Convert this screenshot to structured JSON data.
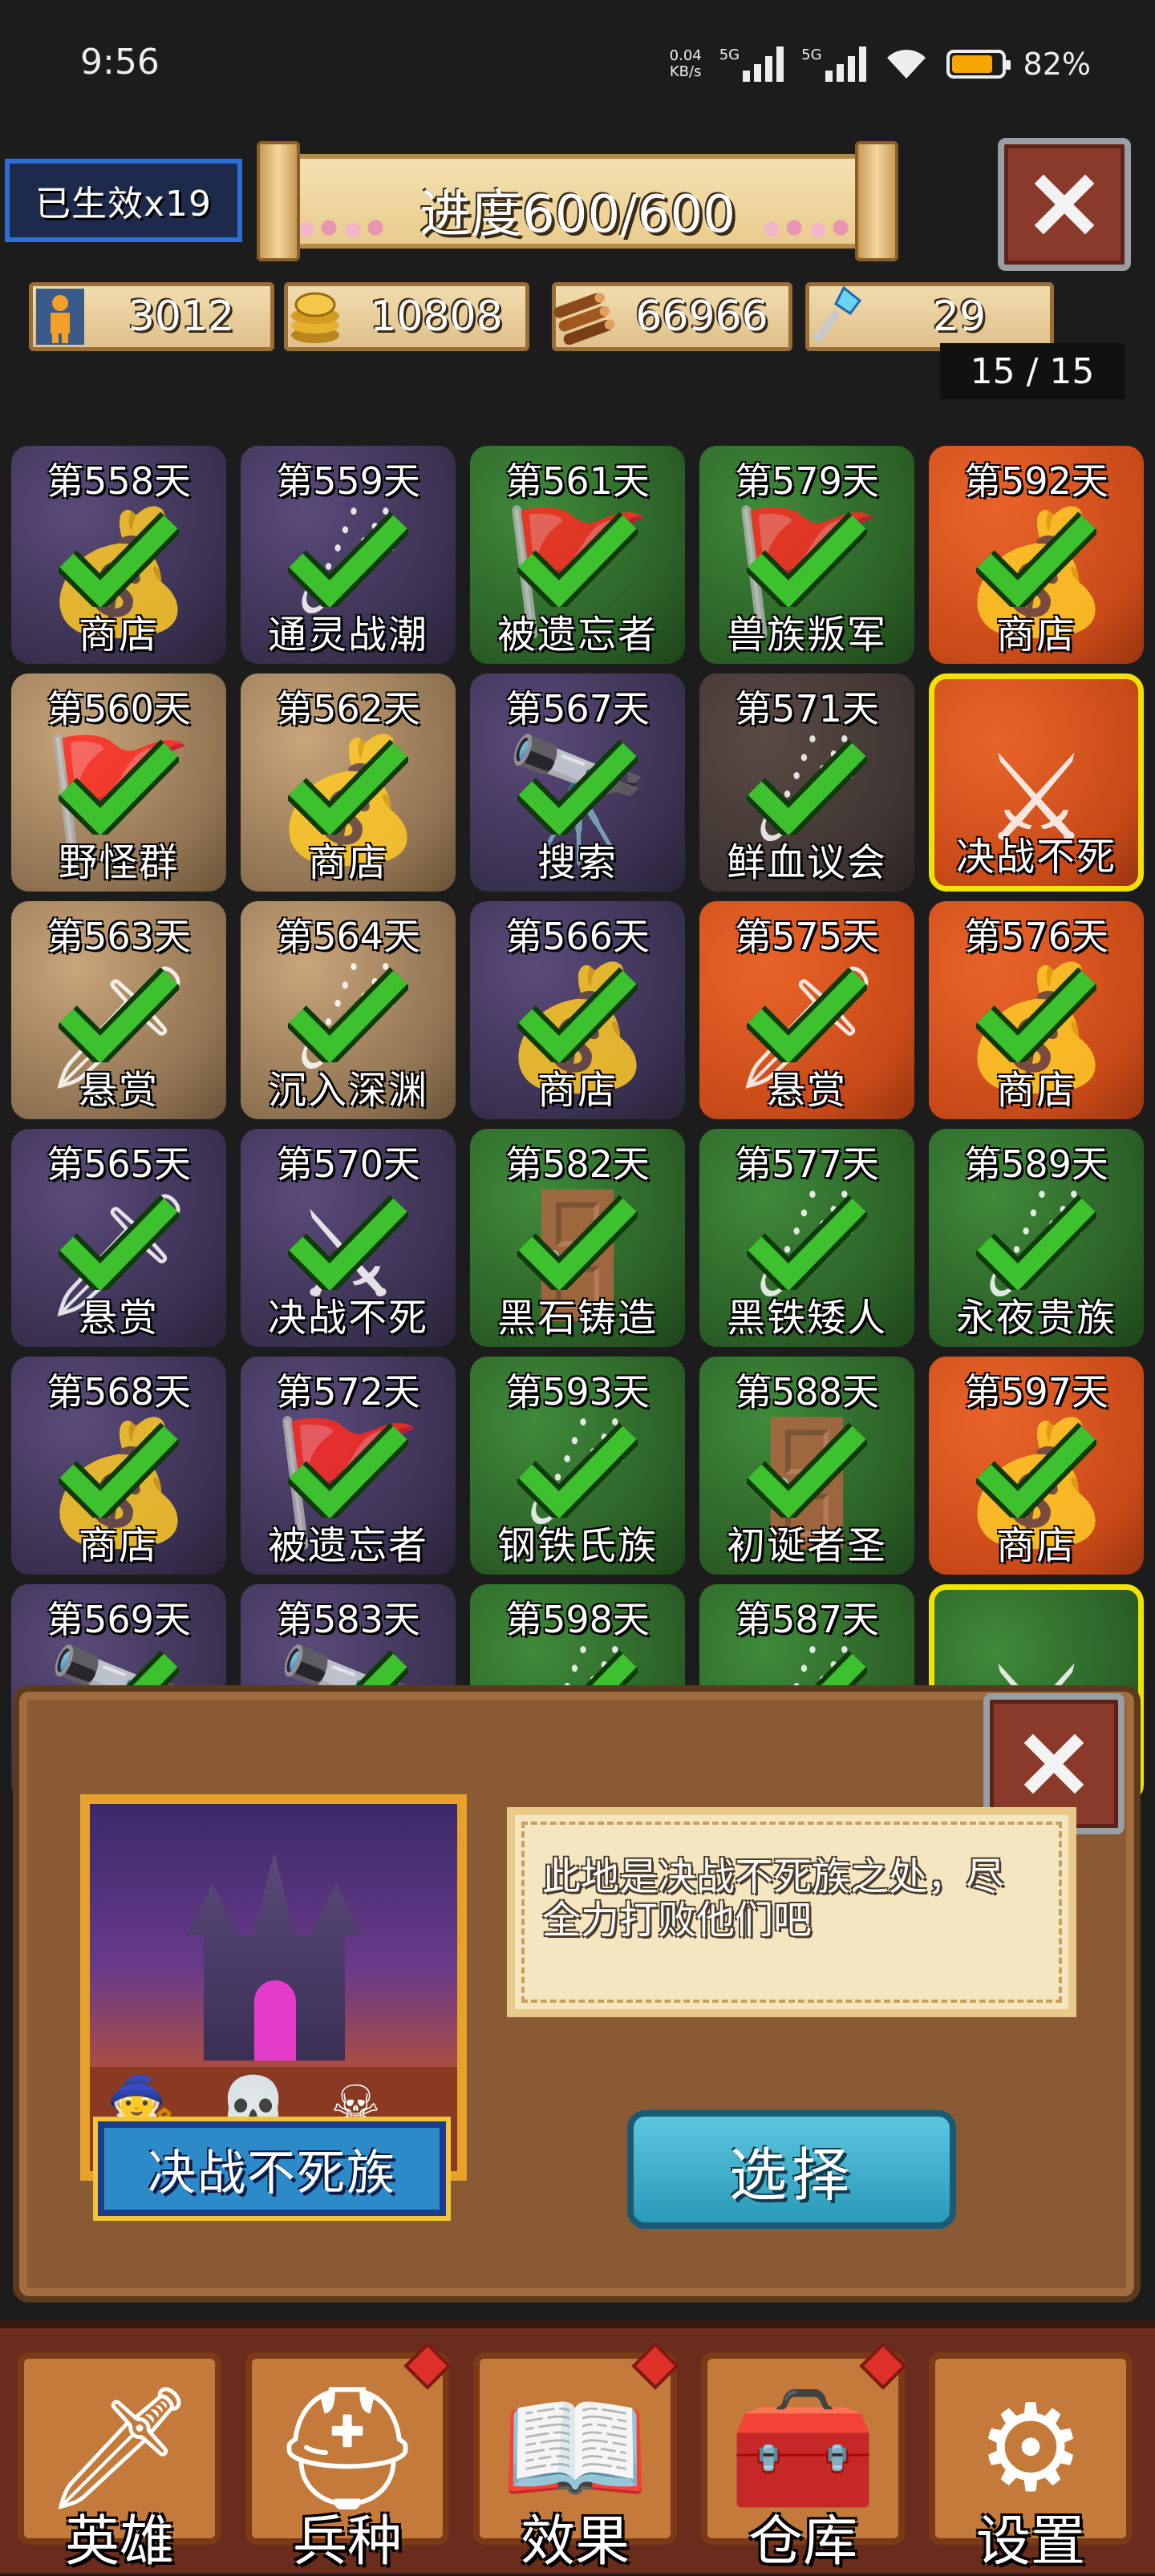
{
  "status_bar": {
    "time": "9:56",
    "net_speed": "0.04",
    "net_unit": "KB/s",
    "sig1_label": "5G",
    "sig2_label": "5G",
    "battery": "82%"
  },
  "header": {
    "effects_label": "已生效x19",
    "progress_title": "进度600/600"
  },
  "resources": [
    {
      "icon": "population-icon",
      "value": "3012"
    },
    {
      "icon": "gold-coins-icon",
      "value": "10808"
    },
    {
      "icon": "wood-logs-icon",
      "value": "66966"
    },
    {
      "icon": "crystal-key-icon",
      "value": "29"
    }
  ],
  "page_indicator": "15 / 15",
  "events": [
    {
      "day": "第558天",
      "name": "商店",
      "bg": "purple",
      "art": "shop"
    },
    {
      "day": "第559天",
      "name": "通灵战潮",
      "bg": "purple",
      "art": "fire"
    },
    {
      "day": "第561天",
      "name": "被遗忘者",
      "bg": "green",
      "art": "banner"
    },
    {
      "day": "第579天",
      "name": "兽族叛军",
      "bg": "green",
      "art": "banner"
    },
    {
      "day": "第592天",
      "name": "商店",
      "bg": "orange",
      "art": "shop"
    },
    {
      "day": "第560天",
      "name": "野怪群",
      "bg": "tan",
      "art": "banner"
    },
    {
      "day": "第562天",
      "name": "商店",
      "bg": "tan",
      "art": "shop"
    },
    {
      "day": "第567天",
      "name": "搜索",
      "bg": "purple",
      "art": "scope"
    },
    {
      "day": "第571天",
      "name": "鲜血议会",
      "bg": "dark",
      "art": "fire"
    },
    {
      "day": "",
      "name": "决战不死",
      "bg": "orange",
      "art": "swords",
      "selected": true,
      "done": false
    },
    {
      "day": "第563天",
      "name": "悬赏",
      "bg": "tan",
      "art": "bounty"
    },
    {
      "day": "第564天",
      "name": "沉入深渊",
      "bg": "tan",
      "art": "fire"
    },
    {
      "day": "第566天",
      "name": "商店",
      "bg": "purple",
      "art": "shop"
    },
    {
      "day": "第575天",
      "name": "悬赏",
      "bg": "orange",
      "art": "bounty"
    },
    {
      "day": "第576天",
      "name": "商店",
      "bg": "orange",
      "art": "shop"
    },
    {
      "day": "第565天",
      "name": "悬赏",
      "bg": "purple",
      "art": "bounty"
    },
    {
      "day": "第570天",
      "name": "决战不死",
      "bg": "purple",
      "art": "swords"
    },
    {
      "day": "第582天",
      "name": "黑石铸造",
      "bg": "green",
      "art": "portal"
    },
    {
      "day": "第577天",
      "name": "黑铁矮人",
      "bg": "green",
      "art": "fire"
    },
    {
      "day": "第589天",
      "name": "永夜贵族",
      "bg": "green",
      "art": "fire"
    },
    {
      "day": "第568天",
      "name": "商店",
      "bg": "purple",
      "art": "shop"
    },
    {
      "day": "第572天",
      "name": "被遗忘者",
      "bg": "purple",
      "art": "banner"
    },
    {
      "day": "第593天",
      "name": "钢铁氏族",
      "bg": "green",
      "art": "fire"
    },
    {
      "day": "第588天",
      "name": "初诞者圣",
      "bg": "green",
      "art": "portal"
    },
    {
      "day": "第597天",
      "name": "商店",
      "bg": "orange",
      "art": "shop"
    },
    {
      "day": "第569天",
      "name": "",
      "bg": "purple",
      "art": "scope"
    },
    {
      "day": "第583天",
      "name": "",
      "bg": "purple",
      "art": "scope"
    },
    {
      "day": "第598天",
      "name": "",
      "bg": "green",
      "art": "fire"
    },
    {
      "day": "第587天",
      "name": "",
      "bg": "green",
      "art": "fire"
    },
    {
      "day": "",
      "name": "",
      "bg": "green",
      "art": "swords",
      "selected": true,
      "done": false
    }
  ],
  "popup": {
    "title": "决战不死族",
    "description": "此地是决战不死族之处，尽全力打败他们吧",
    "choose_label": "选择"
  },
  "bottom_nav": [
    {
      "label": "英雄",
      "icon": "sword-icon",
      "badge": false
    },
    {
      "label": "兵种",
      "icon": "knight-helmet-icon",
      "badge": true
    },
    {
      "label": "效果",
      "icon": "spellbook-icon",
      "badge": true
    },
    {
      "label": "仓库",
      "icon": "treasure-chest-icon",
      "badge": true
    },
    {
      "label": "设置",
      "icon": "gear-icon",
      "badge": false
    }
  ],
  "colors": {
    "check": "#3ec12e",
    "selected_border": "#f2e200",
    "accent_button": "#2a9ab8"
  }
}
